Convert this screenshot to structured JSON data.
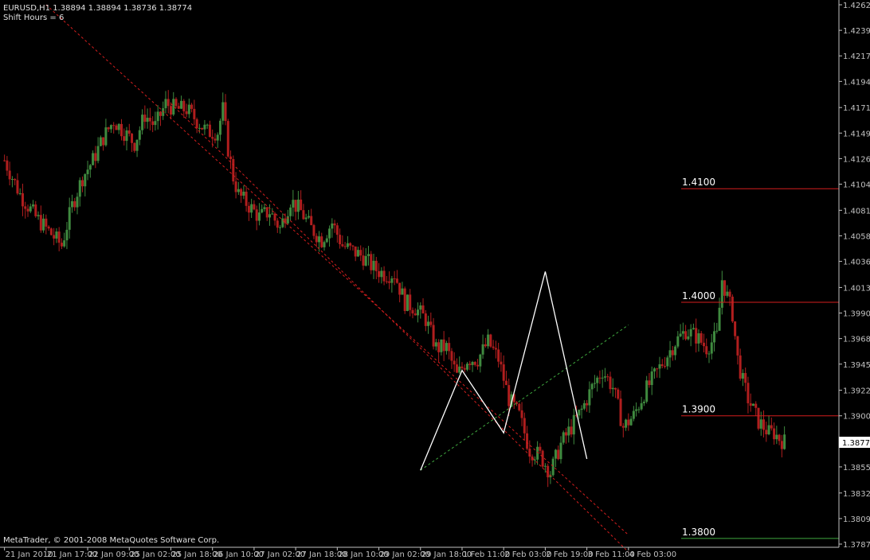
{
  "header": {
    "symbol_line": "EURUSD,H1  1.38894 1.38894 1.38736 1.38774",
    "shift_line": "Shift Hours = 6"
  },
  "footer": {
    "copyright": "MetaTrader, © 2001-2008 MetaQuotes Software Corp."
  },
  "colors": {
    "background": "#000000",
    "bull": "#3f8a3f",
    "bear": "#b01e1e",
    "axis": "#c0c0c0",
    "resistance": "#d41e1e",
    "support": "#3fa83f",
    "pattern": "#ffffff"
  },
  "chart_data": {
    "type": "candlestick",
    "symbol": "EURUSD",
    "timeframe": "H1",
    "last": {
      "open": 1.38894,
      "high": 1.38894,
      "low": 1.38736,
      "close": 1.38774
    },
    "current_price_label": "1.38774",
    "ylim": [
      1.3787,
      1.4262
    ],
    "y_ticks": [
      "1.42620",
      "1.42395",
      "1.42170",
      "1.41945",
      "1.41715",
      "1.41490",
      "1.41265",
      "1.41040",
      "1.40810",
      "1.40585",
      "1.40360",
      "1.40130",
      "1.39905",
      "1.39680",
      "1.39455",
      "1.39225",
      "1.39000",
      "1.38775",
      "1.38550",
      "1.38320",
      "1.38095",
      "1.37870"
    ],
    "x_ticks": [
      "21 Jan 2010",
      "21 Jan 17:00",
      "22 Jan 09:00",
      "25 Jan 02:00",
      "25 Jan 18:00",
      "26 Jan 10:00",
      "27 Jan 02:00",
      "27 Jan 18:00",
      "28 Jan 10:00",
      "29 Jan 02:00",
      "29 Jan 18:00",
      "1 Feb 11:00",
      "2 Feb 03:00",
      "2 Feb 19:00",
      "3 Feb 11:00",
      "4 Feb 03:00"
    ],
    "close_path": [
      [
        0,
        1.4125
      ],
      [
        6,
        1.4095
      ],
      [
        12,
        1.4075
      ],
      [
        18,
        1.406
      ],
      [
        22,
        1.405
      ],
      [
        26,
        1.4085
      ],
      [
        30,
        1.411
      ],
      [
        34,
        1.4125
      ],
      [
        38,
        1.4145
      ],
      [
        42,
        1.416
      ],
      [
        46,
        1.415
      ],
      [
        50,
        1.414
      ],
      [
        54,
        1.4165
      ],
      [
        58,
        1.4155
      ],
      [
        62,
        1.4175
      ],
      [
        66,
        1.417
      ],
      [
        70,
        1.417
      ],
      [
        74,
        1.416
      ],
      [
        78,
        1.415
      ],
      [
        82,
        1.415
      ],
      [
        84,
        1.417
      ],
      [
        86,
        1.4135
      ],
      [
        88,
        1.411
      ],
      [
        90,
        1.4095
      ],
      [
        94,
        1.4085
      ],
      [
        98,
        1.4075
      ],
      [
        102,
        1.408
      ],
      [
        106,
        1.4065
      ],
      [
        110,
        1.409
      ],
      [
        114,
        1.408
      ],
      [
        118,
        1.4065
      ],
      [
        122,
        1.4055
      ],
      [
        126,
        1.407
      ],
      [
        130,
        1.405
      ],
      [
        134,
        1.4045
      ],
      [
        138,
        1.404
      ],
      [
        142,
        1.403
      ],
      [
        146,
        1.4025
      ],
      [
        150,
        1.4025
      ],
      [
        154,
        1.4
      ],
      [
        158,
        1.3995
      ],
      [
        162,
        1.3985
      ],
      [
        166,
        1.396
      ],
      [
        170,
        1.396
      ],
      [
        174,
        1.3935
      ],
      [
        178,
        1.395
      ],
      [
        182,
        1.395
      ],
      [
        186,
        1.3965
      ],
      [
        190,
        1.395
      ],
      [
        194,
        1.3915
      ],
      [
        198,
        1.39
      ],
      [
        202,
        1.387
      ],
      [
        206,
        1.3865
      ],
      [
        210,
        1.385
      ],
      [
        214,
        1.3875
      ],
      [
        218,
        1.389
      ],
      [
        222,
        1.3905
      ],
      [
        226,
        1.3925
      ],
      [
        230,
        1.394
      ],
      [
        234,
        1.3925
      ],
      [
        238,
        1.389
      ],
      [
        242,
        1.39
      ],
      [
        246,
        1.392
      ],
      [
        250,
        1.3935
      ],
      [
        254,
        1.395
      ],
      [
        258,
        1.3965
      ],
      [
        262,
        1.3975
      ],
      [
        266,
        1.397
      ],
      [
        270,
        1.396
      ],
      [
        274,
        1.397
      ],
      [
        276,
        1.402
      ],
      [
        278,
        1.4005
      ],
      [
        280,
        1.399
      ],
      [
        282,
        1.395
      ],
      [
        284,
        1.393
      ],
      [
        286,
        1.3915
      ],
      [
        288,
        1.3905
      ],
      [
        290,
        1.3895
      ],
      [
        292,
        1.389
      ],
      [
        294,
        1.3885
      ],
      [
        296,
        1.3885
      ],
      [
        298,
        1.388
      ],
      [
        300,
        1.3877
      ]
    ],
    "anchors": [
      {
        "label": "21 Jan 2010",
        "i": 0
      },
      {
        "label": "21 Jan 17:00",
        "i": 16
      },
      {
        "label": "22 Jan 09:00",
        "i": 32
      },
      {
        "label": "25 Jan 02:00",
        "i": 48
      },
      {
        "label": "25 Jan 18:00",
        "i": 64
      },
      {
        "label": "26 Jan 10:00",
        "i": 80
      },
      {
        "label": "27 Jan 02:00",
        "i": 96
      },
      {
        "label": "27 Jan 18:00",
        "i": 112
      },
      {
        "label": "28 Jan 10:00",
        "i": 128
      },
      {
        "label": "29 Jan 02:00",
        "i": 144
      },
      {
        "label": "29 Jan 18:00",
        "i": 160
      },
      {
        "label": "1 Feb 11:00",
        "i": 176
      },
      {
        "label": "2 Feb 03:00",
        "i": 192
      },
      {
        "label": "2 Feb 19:00",
        "i": 208
      },
      {
        "label": "3 Feb 11:00",
        "i": 224
      },
      {
        "label": "4 Feb 03:00",
        "i": 240
      }
    ],
    "levels": [
      {
        "label": "1.4100",
        "value": 1.41,
        "color": "#d41e1e"
      },
      {
        "label": "1.4000",
        "value": 1.4,
        "color": "#d41e1e"
      },
      {
        "label": "1.3900",
        "value": 1.39,
        "color": "#d41e1e"
      },
      {
        "label": "1.3800",
        "value": 1.3792,
        "color": "#3fa83f"
      }
    ],
    "trendlines": [
      {
        "name": "resistance upper",
        "color": "#d41e1e",
        "points": [
          [
            "21 Jan 17:00",
            1.4262
          ],
          [
            "4 Feb 03:00",
            1.3795
          ]
        ]
      },
      {
        "name": "resistance lower",
        "color": "#d41e1e",
        "points": [
          [
            "25 Jan 18:00",
            1.4175
          ],
          [
            "4 Feb 03:00",
            1.378
          ]
        ]
      },
      {
        "name": "support",
        "color": "#3fa83f",
        "points": [
          [
            "29 Jan 18:00",
            1.3852
          ],
          [
            "4 Feb 03:00",
            1.398
          ]
        ]
      }
    ],
    "pattern": [
      [
        "29 Jan 18:00",
        1.3852
      ],
      [
        "1 Feb 11:00",
        1.394
      ],
      [
        "2 Feb 03:00",
        1.3885
      ],
      [
        "2 Feb 19:00",
        1.4027
      ],
      [
        "3 Feb 11:00",
        1.3862
      ]
    ],
    "grid": false,
    "legend": "none"
  }
}
